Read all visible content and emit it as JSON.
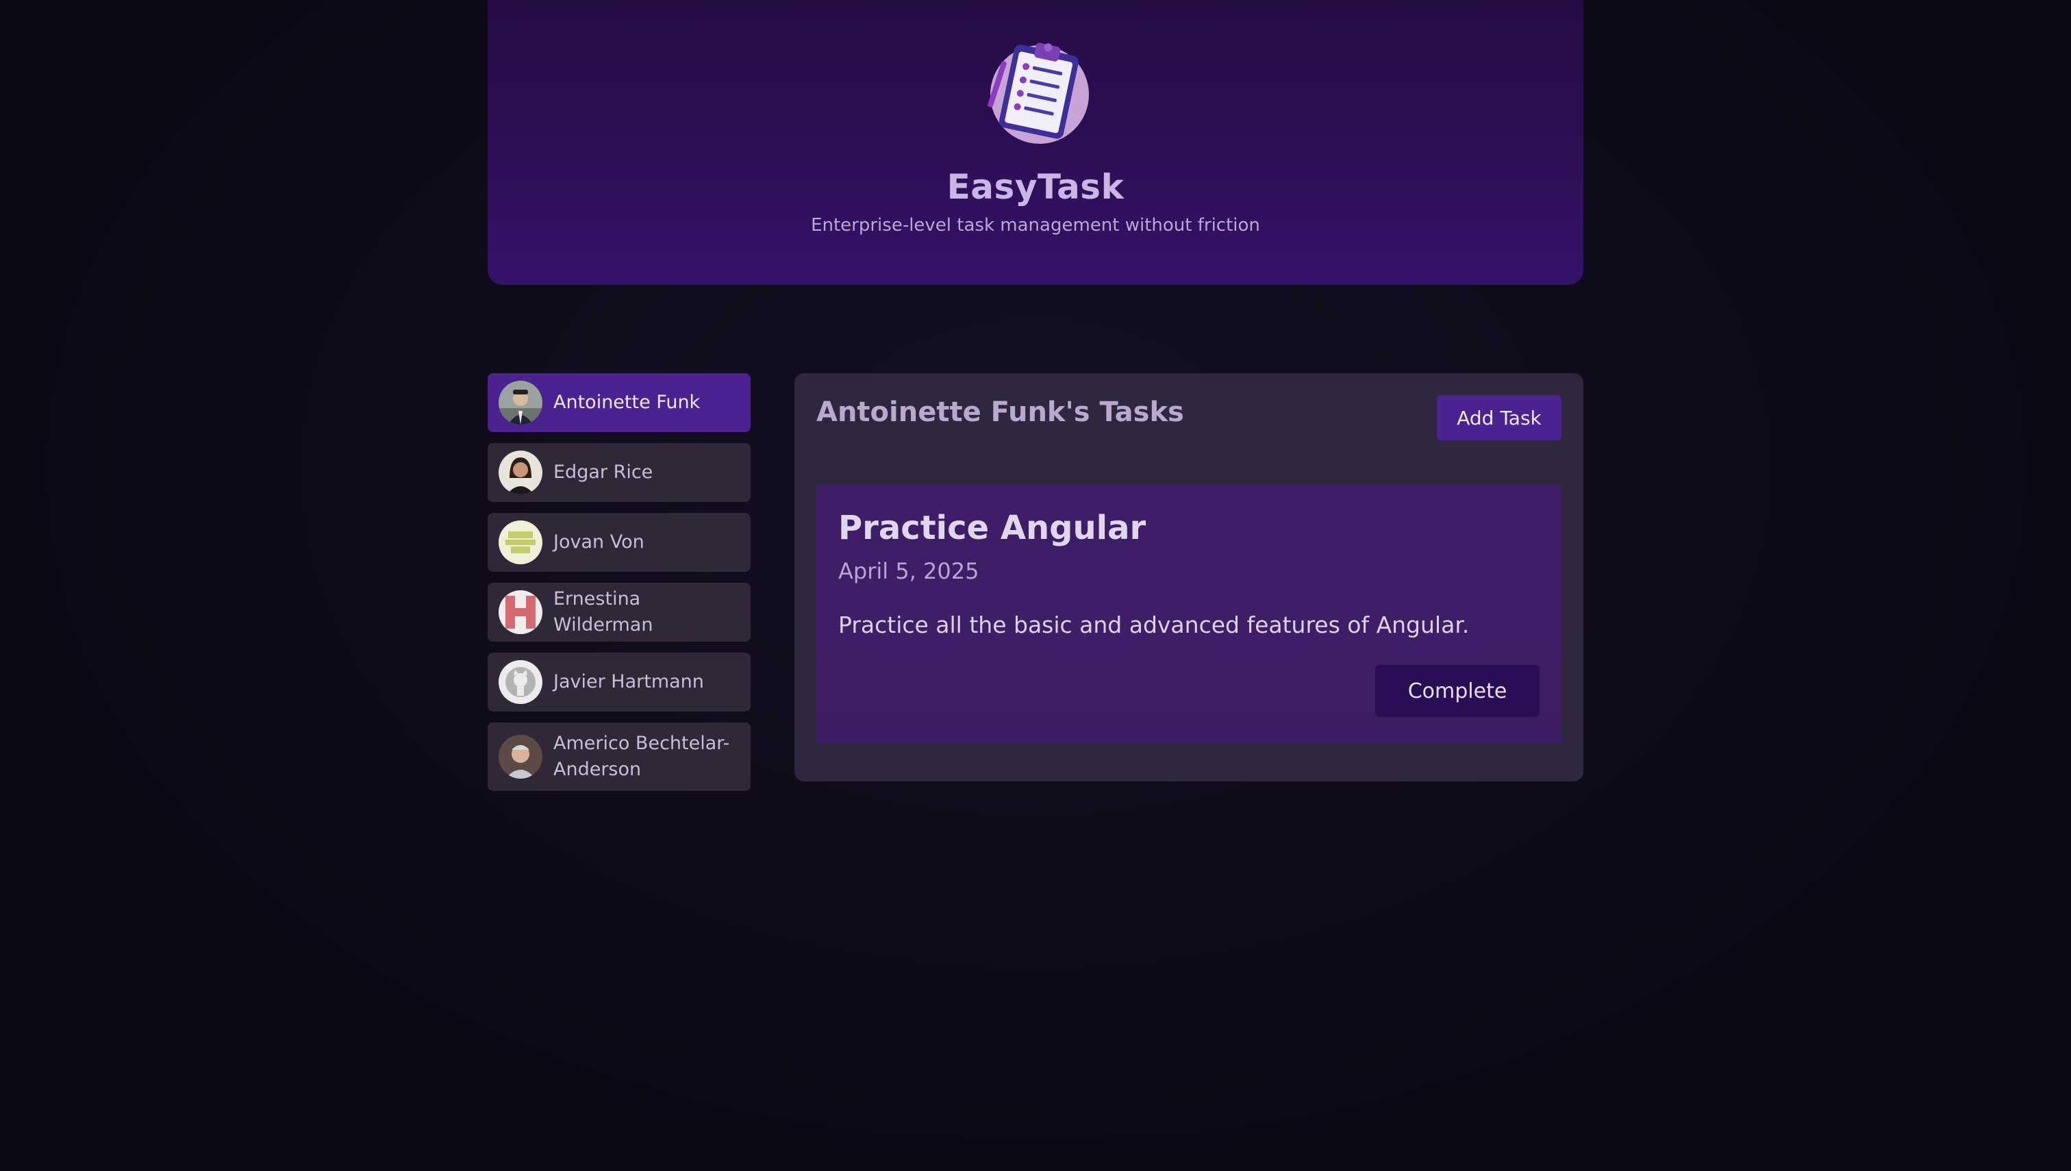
{
  "header": {
    "title": "EasyTask",
    "subtitle": "Enterprise-level task management without friction",
    "logo_icon": "clipboard-task-list-icon"
  },
  "users": [
    {
      "name": "Antoinette Funk",
      "active": true
    },
    {
      "name": "Edgar Rice",
      "active": false
    },
    {
      "name": "Jovan Von",
      "active": false
    },
    {
      "name": "Ernestina Wilderman",
      "active": false
    },
    {
      "name": "Javier Hartmann",
      "active": false
    },
    {
      "name": "Americo Bechtelar-Anderson",
      "active": false
    }
  ],
  "tasks_panel": {
    "title": "Antoinette Funk's Tasks",
    "add_task_label": "Add Task",
    "tasks": [
      {
        "title": "Practice Angular",
        "date": "April 5, 2025",
        "summary": "Practice all the basic and advanced features of Angular.",
        "complete_label": "Complete"
      }
    ]
  },
  "colors": {
    "background": "#0c0915",
    "header": "#2d0f55",
    "accent": "#4a2390",
    "panel": "#2f273d",
    "card": "#3f1d68",
    "user_item": "#302838"
  }
}
